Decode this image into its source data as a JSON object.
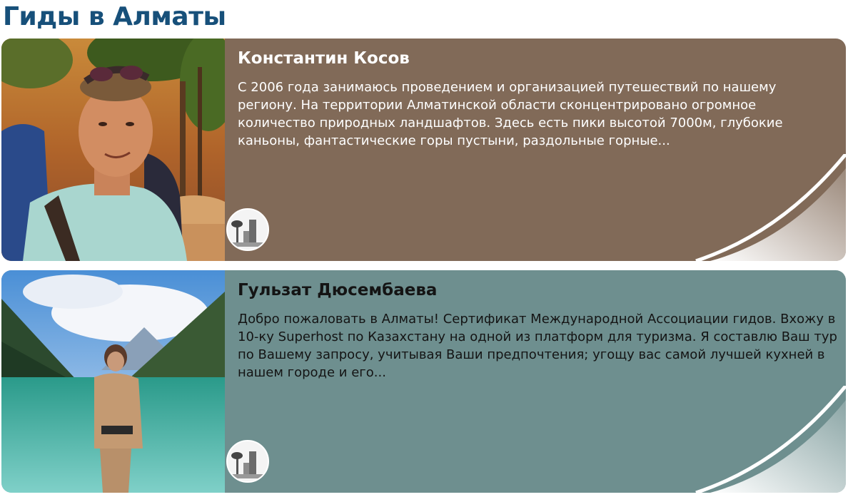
{
  "page": {
    "title": "Гиды в Алматы"
  },
  "guides": [
    {
      "name": "Константин Косов",
      "description": "С 2006 года занимаюсь проведением и организацией путешествий по нашему региону. На территории Алматинской области сконцентрировано огромное количество природных ландшафтов. Здесь есть пики высотой 7000м, глубокие каньоны, фантастические горы пустыни, раздольные горные...",
      "card_color": "#816a58",
      "text_color": "#ffffff"
    },
    {
      "name": "Гульзат Дюсембаева",
      "description": "Добро пожаловать в Алматы! Сертификат Международной Ассоциации гидов. Вхожу в 10-ку Superhost по Казахстану на одной из платформ для туризма. Я составлю Ваш тур по Вашему запросу, учитывая Ваши предпочтения; угощу вас самой лучшей кухней в нашем городе и его...",
      "card_color": "#6e8f8f",
      "text_color": "#141414"
    }
  ],
  "title_color": "#17507a",
  "icons": {
    "city_badge": "almaty-city-icon"
  }
}
